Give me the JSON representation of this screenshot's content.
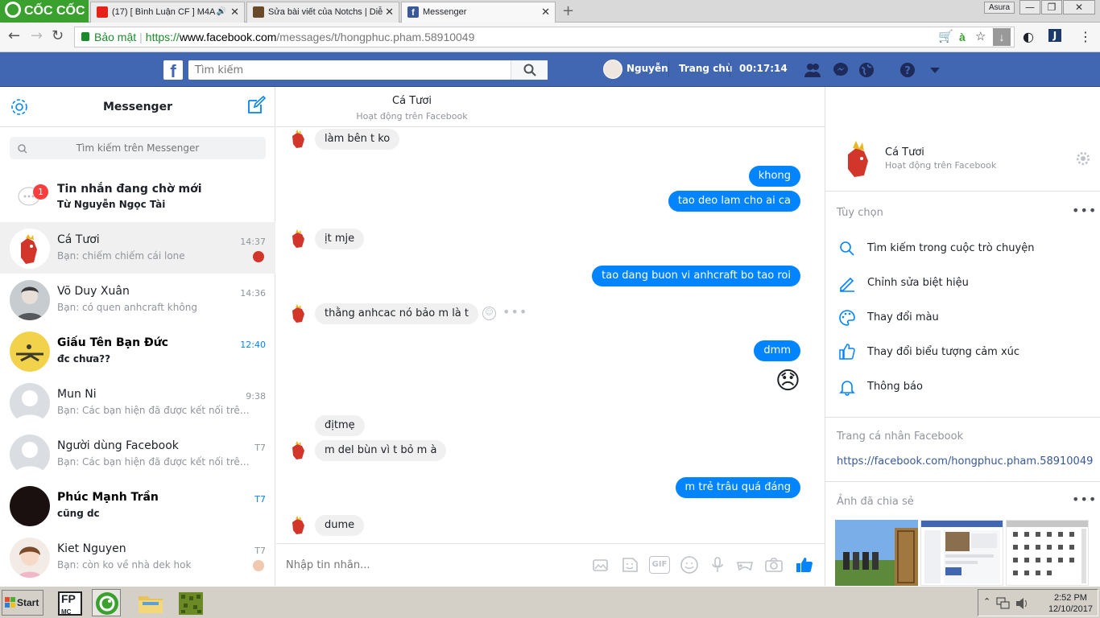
{
  "browser": {
    "logo": "CỐC CỐC",
    "tabs": [
      {
        "title": "(17) [ Bình Luận CF ] M4A"
      },
      {
        "title": "Sửa bài viết của Notchs | Diễ"
      },
      {
        "title": "Messenger"
      }
    ],
    "user_label": "Asura",
    "security_label": "Bảo mật",
    "url_scheme": "https://",
    "url_host": "www.facebook.com",
    "url_path": "/messages/t/hongphuc.pham.58910049"
  },
  "fb": {
    "logo": "f",
    "search_placeholder": "Tìm kiếm",
    "profile_name": "Nguyễn",
    "home": "Trang chủ",
    "timer": "00:17:14"
  },
  "left": {
    "title": "Messenger",
    "search_placeholder": "Tìm kiếm trên Messenger",
    "pending": {
      "title": "Tin nhắn đang chờ mới",
      "from": "Từ Nguyễn Ngọc Tài",
      "badge": "1"
    },
    "conversations": [
      {
        "name": "Cá Tươi",
        "preview": "Bạn: chiếm chiếm cái lone",
        "time": "14:37"
      },
      {
        "name": "Võ Duy Xuân",
        "preview": "Bạn: có quen anhcraft không",
        "time": "14:36"
      },
      {
        "name": "Giấu Tên Bạn Đức",
        "preview": "đc chưa??",
        "time": "12:40"
      },
      {
        "name": "Mun Ni",
        "preview": "Bạn: Các bạn hiện đã được kết nối trên...",
        "time": "9:38"
      },
      {
        "name": "Người dùng Facebook",
        "preview": "Bạn: Các bạn hiện đã được kết nối trên...",
        "time": "T7"
      },
      {
        "name": "Phúc Mạnh Trần",
        "preview": "cũng dc",
        "time": "T7"
      },
      {
        "name": "Kiet Nguyen",
        "preview": "Bạn: còn ko về nhà dek hok",
        "time": "T7"
      }
    ]
  },
  "chat": {
    "name": "Cá Tươi",
    "status": "Hoạt động trên Facebook",
    "messages": [
      {
        "text": "làm bên t ko",
        "dir": "in"
      },
      {
        "text": "khong",
        "dir": "out"
      },
      {
        "text": "tao deo lam cho ai ca",
        "dir": "out"
      },
      {
        "text": "ịt mje",
        "dir": "in"
      },
      {
        "text": "tao dang buon vi anhcraft bo tao roi",
        "dir": "out"
      },
      {
        "text": "thằng anhcac nó bảo m là t",
        "dir": "in"
      },
      {
        "text": "dmm",
        "dir": "out"
      },
      {
        "text": "😞",
        "dir": "out"
      },
      {
        "text": "địtmẹ",
        "dir": "in"
      },
      {
        "text": "m del bùn vì t bỏ m à",
        "dir": "in"
      },
      {
        "text": "m trẻ trâu quá đáng",
        "dir": "out"
      },
      {
        "text": "dume",
        "dir": "in"
      }
    ],
    "composer_placeholder": "Nhập tin nhắn...",
    "gif_label": "GIF"
  },
  "right": {
    "name": "Cá Tươi",
    "status": "Hoạt động trên Facebook",
    "options_title": "Tùy chọn",
    "options": [
      {
        "label": "Tìm kiếm trong cuộc trò chuyện",
        "icon": "search-icon"
      },
      {
        "label": "Chỉnh sửa biệt hiệu",
        "icon": "pencil-icon"
      },
      {
        "label": "Thay đổi màu",
        "icon": "palette-icon"
      },
      {
        "label": "Thay đổi biểu tượng cảm xúc",
        "icon": "thumbs-up-icon"
      },
      {
        "label": "Thông báo",
        "icon": "bell-icon"
      }
    ],
    "profile_title": "Trang cá nhân Facebook",
    "profile_link": "https://facebook.com/hongphuc.pham.58910049",
    "shared_title": "Ảnh đã chia sẻ"
  },
  "taskbar": {
    "start": "Start",
    "time": "2:52 PM",
    "date": "12/10/2017"
  },
  "colors": {
    "fb_blue": "#4267b2",
    "messenger_blue": "#0084ff",
    "coccoc_green": "#3aa12e"
  }
}
